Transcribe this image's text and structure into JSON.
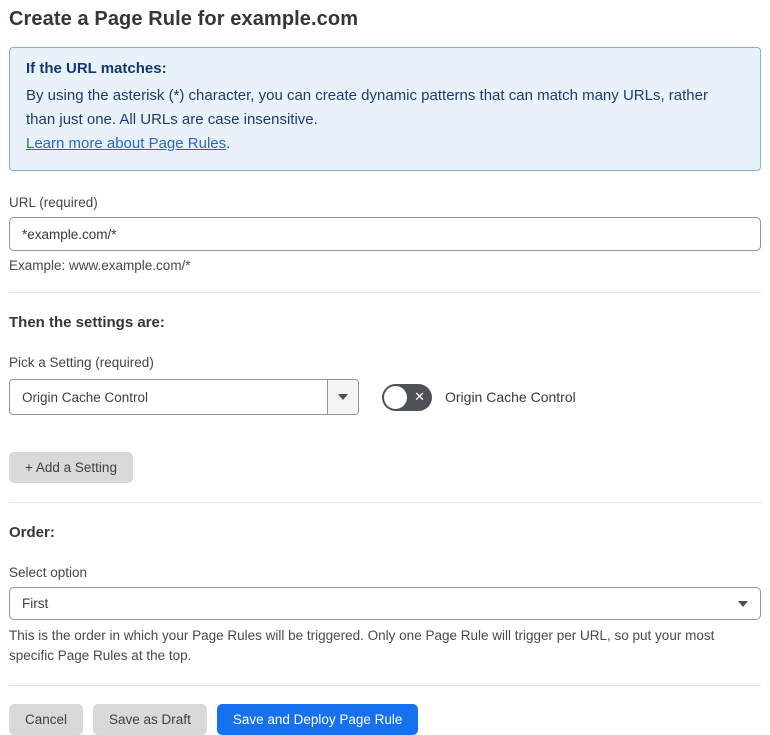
{
  "page": {
    "title": "Create a Page Rule for example.com"
  },
  "info_box": {
    "heading": "If the URL matches:",
    "body": "By using the asterisk (*) character, you can create dynamic patterns that can match many URLs, rather than just one. All URLs are case insensitive.",
    "link_label": "Learn more about Page Rules",
    "link_suffix": "."
  },
  "url_field": {
    "label": "URL (required)",
    "value": "*example.com/*",
    "example": "Example: www.example.com/*"
  },
  "settings_section": {
    "heading": "Then the settings are:",
    "picker_label": "Pick a Setting (required)",
    "picker_value": "Origin Cache Control",
    "toggle_state": "off",
    "toggle_label": "Origin Cache Control",
    "add_setting_button": "+ Add a Setting"
  },
  "order_section": {
    "heading": "Order:",
    "select_label": "Select option",
    "select_value": "First",
    "help_text": "This is the order in which your Page Rules will be triggered. Only one Page Rule will trigger per URL, so put your most specific Page Rules at the top."
  },
  "footer": {
    "cancel_label": "Cancel",
    "save_draft_label": "Save as Draft",
    "save_deploy_label": "Save and Deploy Page Rule"
  },
  "colors": {
    "accent_blue": "#1671ef",
    "info_box_bg": "#e9f2fb",
    "info_box_border": "#7fb0dc",
    "info_text": "#1d3c6e",
    "link_blue": "#2a66c8",
    "toggle_track": "#4e5256",
    "gray_button_bg": "#d9d9d9",
    "divider": "#e2e3e4"
  },
  "icons": {
    "toggle_off_glyph": "✕"
  }
}
